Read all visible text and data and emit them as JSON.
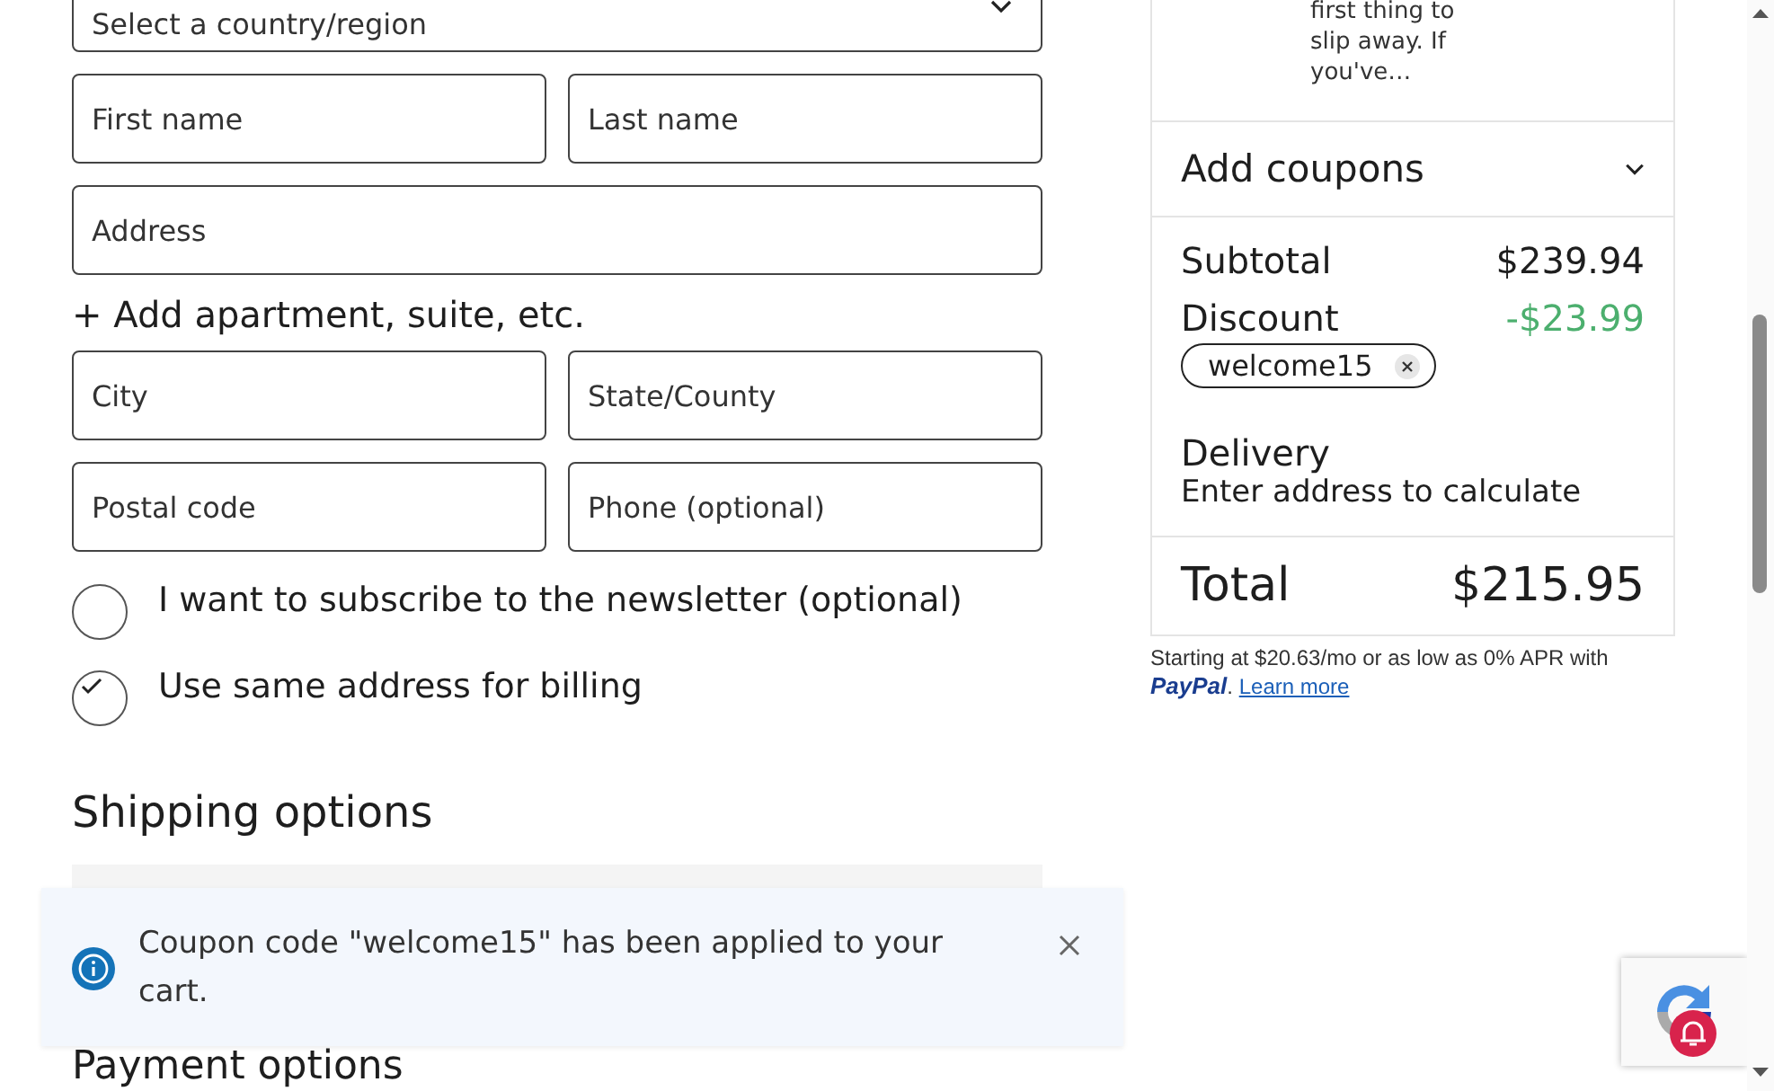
{
  "country_select": {
    "placeholder": "Select a country/region"
  },
  "address_form": [
    {
      "kind": "half",
      "placeholder": "First name"
    },
    {
      "kind": "half",
      "placeholder": "Last name"
    },
    {
      "kind": "full",
      "placeholder": "Address"
    },
    {
      "kind": "link",
      "label": "+ Add apartment, suite, etc."
    },
    {
      "kind": "half",
      "placeholder": "City"
    },
    {
      "kind": "half",
      "placeholder": "State/County"
    },
    {
      "kind": "half",
      "placeholder": "Postal code"
    },
    {
      "kind": "half",
      "placeholder": "Phone (optional)"
    }
  ],
  "options": [
    {
      "label": "I want to subscribe to the newsletter (optional)",
      "checked": false
    },
    {
      "label": "Use same address for billing",
      "checked": true
    }
  ],
  "shipping_heading": "Shipping options",
  "payment_heading": "Payment options",
  "order_summary": {
    "product_description": "first thing to slip away. If you've…",
    "coupons_label": "Add coupons",
    "subtotal_label": "Subtotal",
    "subtotal": "$239.94",
    "discount_label": "Discount",
    "discount": "-$23.99",
    "coupon_code": "welcome15",
    "delivery_label": "Delivery",
    "delivery_note": "Enter address to calculate",
    "total_label": "Total",
    "total": "$215.95"
  },
  "paypal_message": {
    "text": "Starting at $20.63/mo or as low as 0% APR with",
    "brand": "PayPal",
    "after": ".",
    "link": "Learn more"
  },
  "toast": {
    "message": "Coupon code \"welcome15\" has been applied to your cart."
  }
}
